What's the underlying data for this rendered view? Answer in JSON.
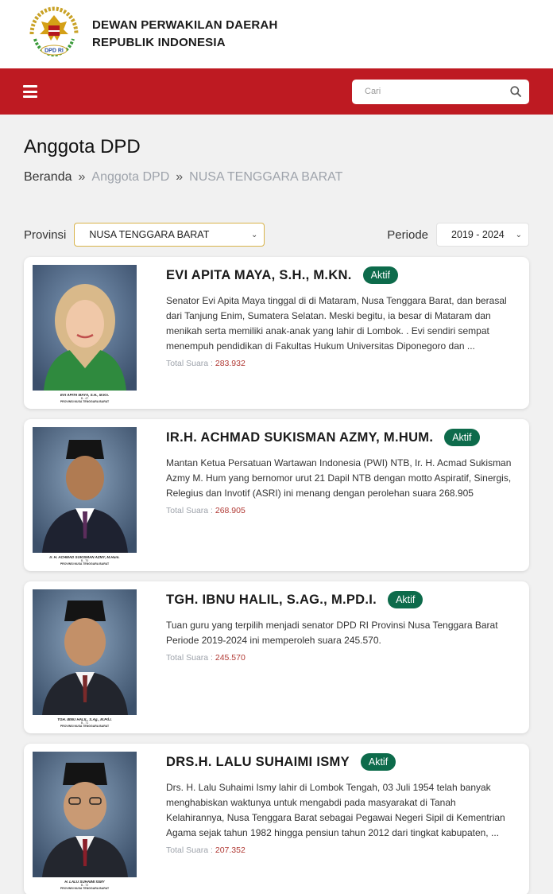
{
  "header": {
    "title_line1": "DEWAN PERWAKILAN DAERAH",
    "title_line2": "REPUBLIK INDONESIA",
    "logo_text": "DPD RI"
  },
  "navbar": {
    "search_placeholder": "Cari",
    "menu_icon": "hamburger-icon",
    "search_icon": "search-icon"
  },
  "page": {
    "title": "Anggota DPD",
    "breadcrumb": {
      "home": "Beranda",
      "sep": "»",
      "level1": "Anggota DPD",
      "level2": "NUSA TENGGARA BARAT"
    }
  },
  "filters": {
    "province_label": "Provinsi",
    "province_value": "NUSA TENGGARA BARAT",
    "period_label": "Periode",
    "period_value": "2019 - 2024"
  },
  "members": [
    {
      "name": "EVI APITA MAYA, S.H., M.KN.",
      "status": "Aktif",
      "description": "Senator Evi Apita Maya tinggal di di Mataram, Nusa Tenggara Barat, dan berasal dari Tanjung Enim, Sumatera Selatan. Meski begitu, ia besar di Mataram dan menikah serta memiliki anak-anak yang lahir di Lombok. . Evi sendiri sempat menempuh pendidikan di Fakultas Hukum Universitas Diponegoro dan ...",
      "votes_label": "Total Suara :",
      "votes": "283.932",
      "caption1": "EVI APITA MAYA, S.H., M.Kn.",
      "caption2": "B - 47",
      "caption3": "PROVINSI NUSA TENGGARA BARAT"
    },
    {
      "name": "IR.H. ACHMAD SUKISMAN AZMY, M.HUM.",
      "status": "Aktif",
      "description": "Mantan Ketua Persatuan Wartawan Indonesia (PWI) NTB, Ir. H. Acmad Sukisman Azmy M. Hum yang bernomor urut 21 Dapil NTB dengan motto Aspiratif, Sinergis, Relegius dan Invotif (ASRI) ini menang dengan perolehan suara 268.905",
      "votes_label": "Total Suara :",
      "votes": "268.905",
      "caption1": "Ir. H. ACHMAD SUKISMAN AZMY, M.Hum.",
      "caption2": "B - 70",
      "caption3": "PROVINSI NUSA TENGGARA BARAT"
    },
    {
      "name": "TGH. IBNU HALIL, S.AG., M.PD.I.",
      "status": "Aktif",
      "description": "Tuan guru yang terpilih menjadi senator DPD RI Provinsi Nusa Tenggara Barat Periode 2019-2024 ini memperoleh suara 245.570.",
      "votes_label": "Total Suara :",
      "votes": "245.570",
      "caption1": "TGH. IBNU HALIL, S.Ag., M.Pd.I.",
      "caption2": "B - 71",
      "caption3": "PROVINSI NUSA TENGGARA BARAT"
    },
    {
      "name": "DRS.H. LALU SUHAIMI ISMY",
      "status": "Aktif",
      "description": "Drs. H. Lalu Suhaimi Ismy lahir di Lombok Tengah, 03 Juli 1954 telah banyak menghabiskan waktunya untuk mengabdi pada masyarakat di Tanah Kelahirannya, Nusa Tenggara Barat sebagai Pegawai Negeri Sipil di Kementrian Agama sejak tahun 1982 hingga pensiun tahun 2012 dari tingkat kabupaten, ...",
      "votes_label": "Total Suara :",
      "votes": "207.352",
      "caption1": "H. LALU SUHAIMI ISMY",
      "caption2": "B - 72",
      "caption3": "PROVINSI NUSA TENGGARA BARAT"
    }
  ],
  "colors": {
    "brand_red": "#be1a22",
    "badge_green": "#0d6b4b",
    "votes_red": "#b13a35"
  }
}
